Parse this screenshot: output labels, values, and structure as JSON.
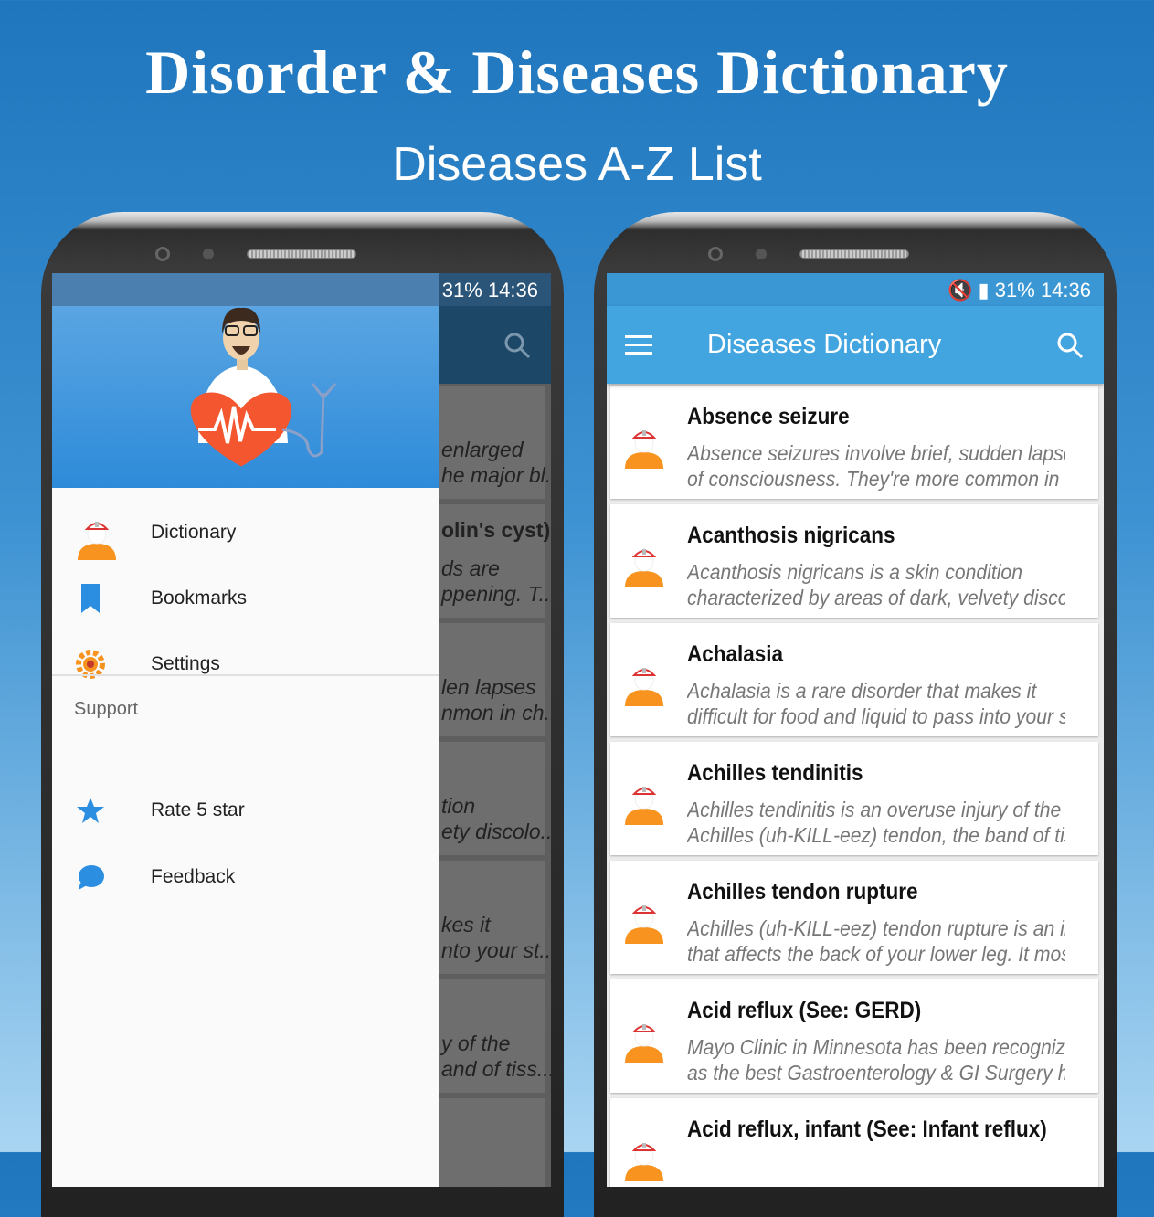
{
  "banner": {
    "title": "Disorder & Diseases Dictionary",
    "subtitle": "Diseases A-Z List"
  },
  "status": {
    "battery": "31%",
    "time": "14:36"
  },
  "left": {
    "menu": [
      {
        "label": "Dictionary",
        "icon": "doctor-icon"
      },
      {
        "label": "Bookmarks",
        "icon": "bookmark-icon"
      },
      {
        "label": "Settings",
        "icon": "gear-icon"
      }
    ],
    "support_header": "Support",
    "support": [
      {
        "label": "Rate 5 star",
        "icon": "star-icon"
      },
      {
        "label": "Feedback",
        "icon": "chat-bubble-icon"
      }
    ],
    "background_fragments": [
      "enlarged",
      "he major bl...",
      "olin's cyst)",
      "ds are",
      "ppening. T...",
      "len lapses",
      "nmon in ch...",
      "tion",
      "ety discolo...",
      "kes it",
      "nto your st...",
      "y of the",
      "and of tiss..."
    ]
  },
  "right": {
    "toolbar_title": "Diseases Dictionary",
    "items": [
      {
        "title": "Absence seizure",
        "desc1": "Absence seizures involve brief, sudden lapses",
        "desc2": "of consciousness. They're more common in ch..."
      },
      {
        "title": "Acanthosis nigricans",
        "desc1": "Acanthosis nigricans is a skin condition",
        "desc2": "characterized by areas of dark, velvety discolo..."
      },
      {
        "title": "Achalasia",
        "desc1": "Achalasia is a rare disorder that makes it",
        "desc2": "difficult for food and liquid to pass into your st..."
      },
      {
        "title": "Achilles tendinitis",
        "desc1": "Achilles tendinitis is an overuse injury of the",
        "desc2": "Achilles (uh-KILL-eez) tendon, the band of tiss..."
      },
      {
        "title": "Achilles tendon rupture",
        "desc1": "Achilles (uh-KILL-eez) tendon rupture is an injury",
        "desc2": "that affects the back of your lower leg. It most ..."
      },
      {
        "title": "Acid reflux (See: GERD)",
        "desc1": "Mayo Clinic in Minnesota has been recognized",
        "desc2": "as the best Gastroenterology & GI Surgery hos..."
      },
      {
        "title": "Acid reflux, infant (See: Infant reflux)",
        "desc1": "",
        "desc2": ""
      }
    ]
  },
  "colors": {
    "primary": "#42a5e0",
    "status_bar": "#3a97d4",
    "accent": "#ff9800"
  }
}
